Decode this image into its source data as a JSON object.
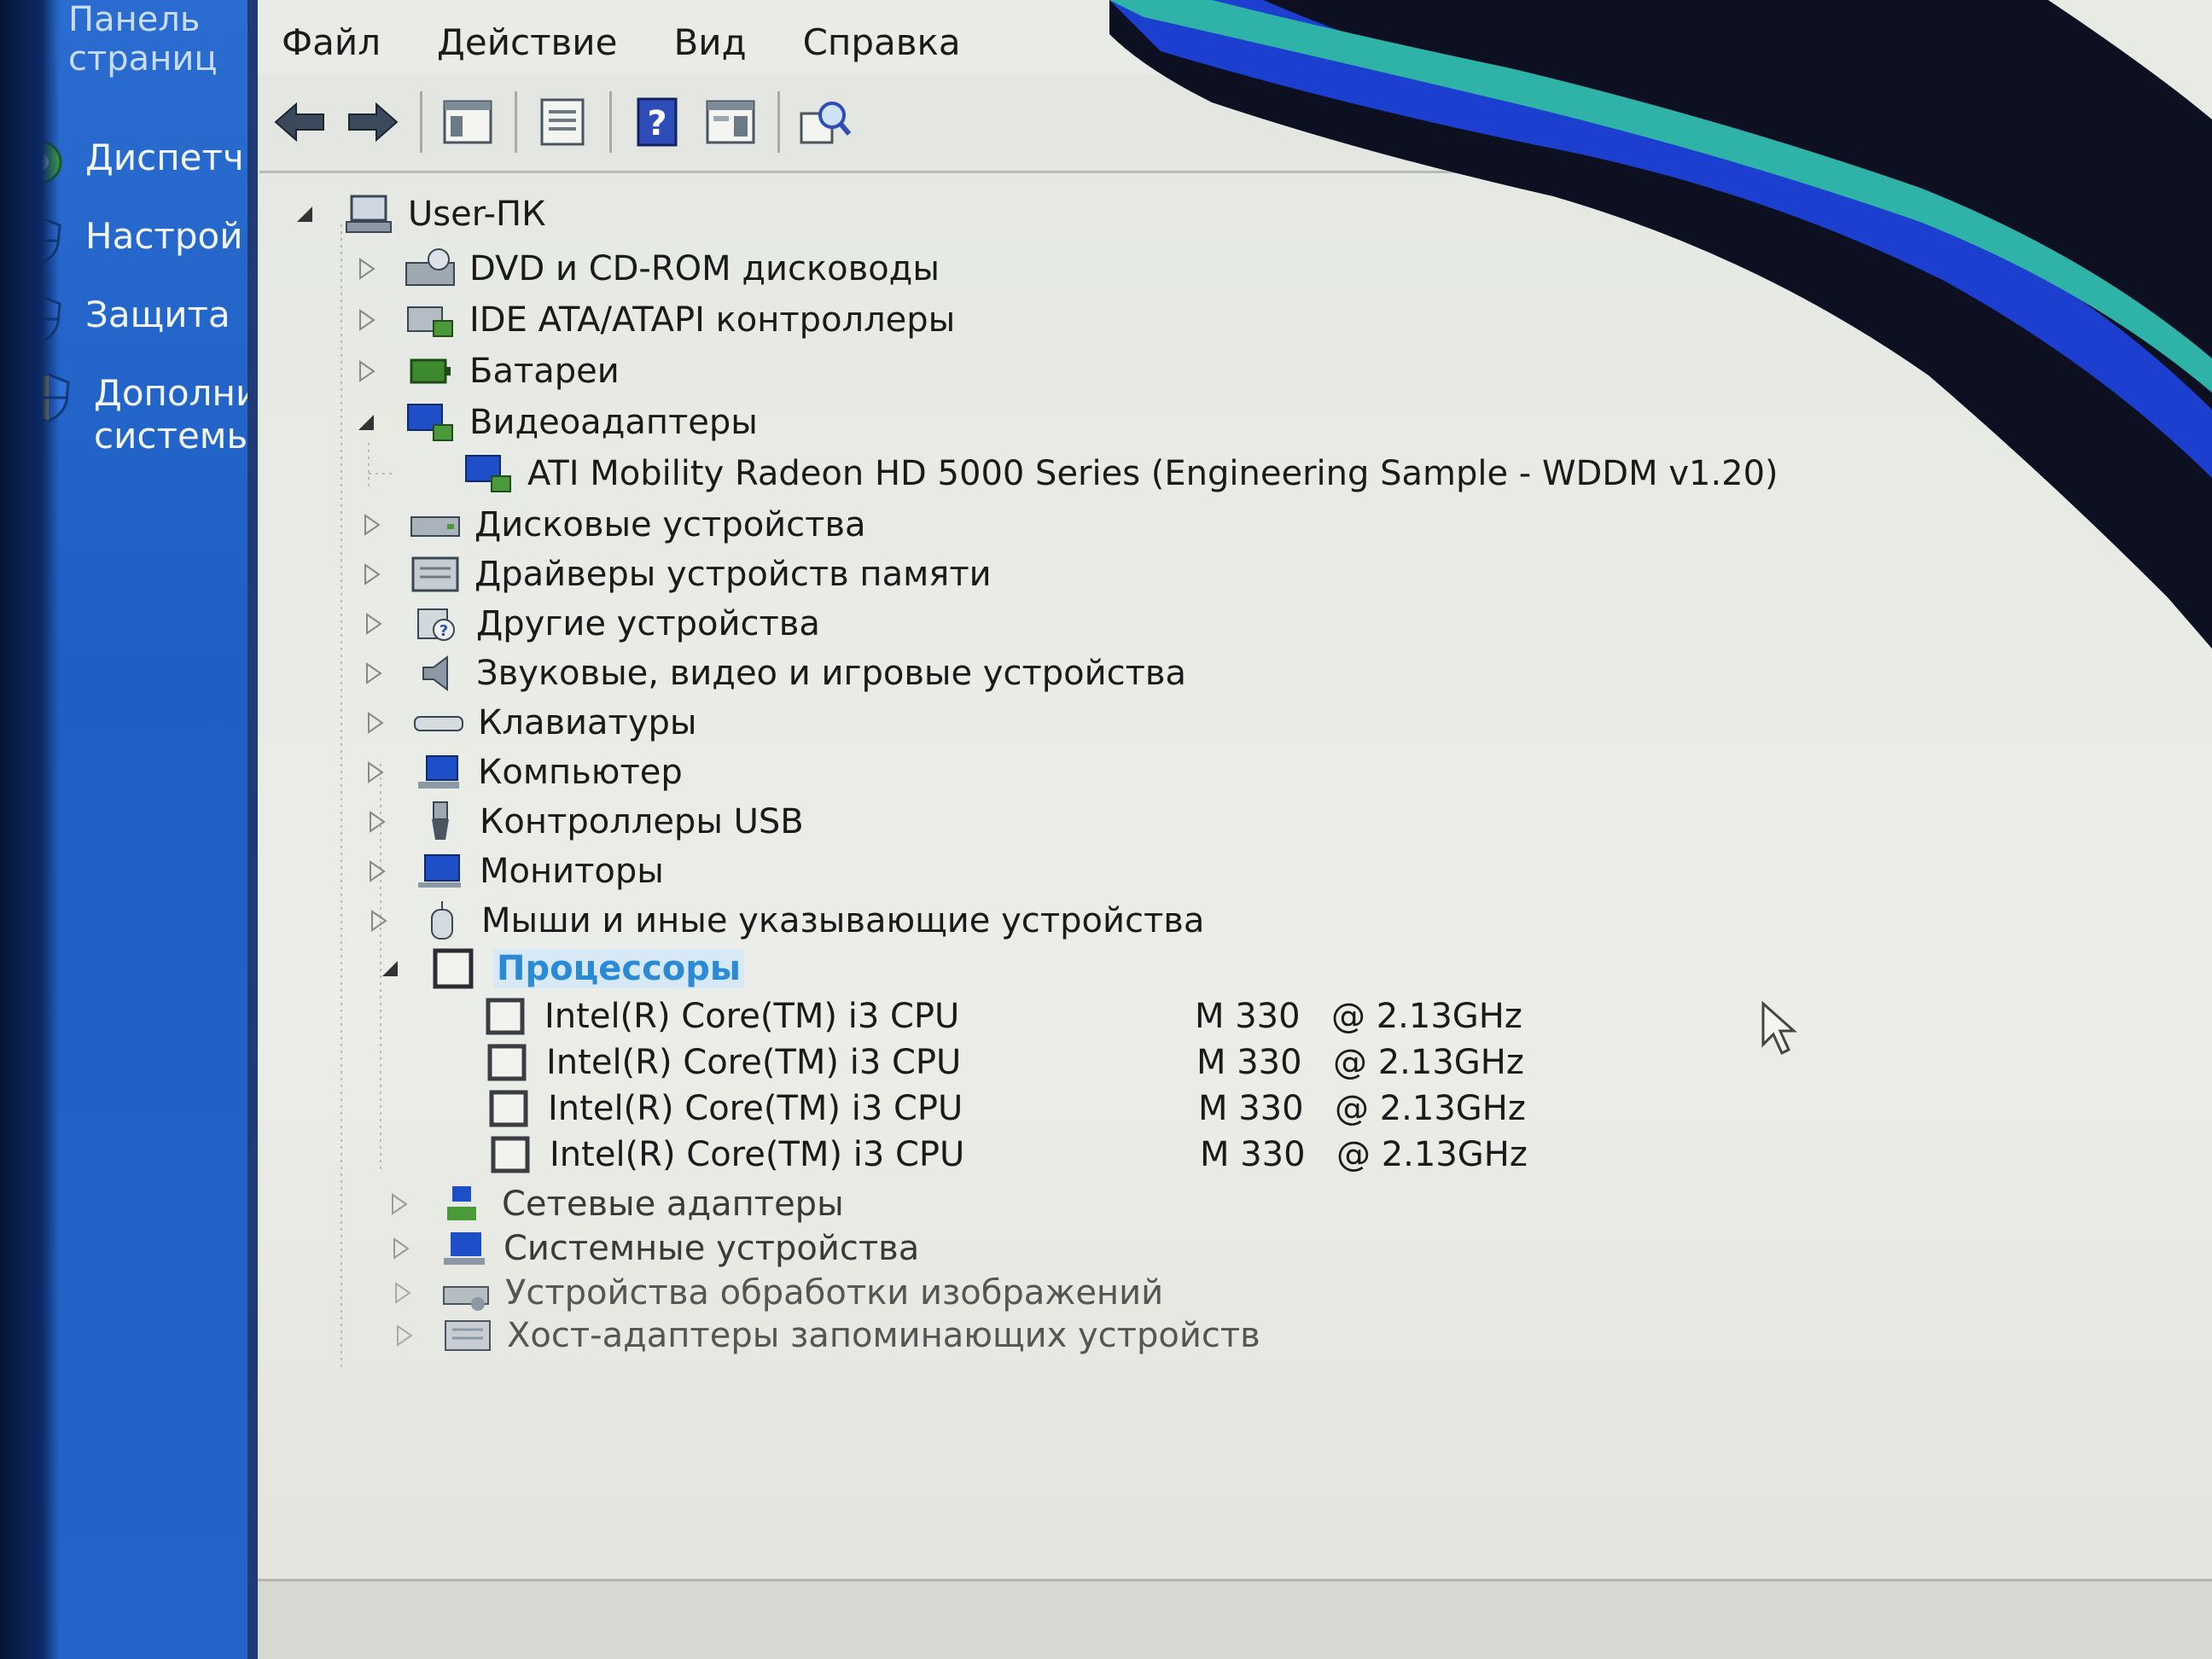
{
  "left_pane": {
    "breadcrumb": "Панель\nстраниц",
    "tasks": [
      {
        "label": "Диспетч",
        "icon": "device-manager-icon"
      },
      {
        "label": "Настрой",
        "icon": "shield-icon"
      },
      {
        "label": "Защита",
        "icon": "shield-icon"
      },
      {
        "label": "Дополни\nсистемы",
        "icon": "shield-icon"
      }
    ]
  },
  "menubar": {
    "file": "Файл",
    "action": "Действие",
    "view": "Вид",
    "help": "Справка"
  },
  "toolbar": {
    "buttons": [
      "back-arrow-icon",
      "forward-arrow-icon",
      "show-hide-tree-icon",
      "properties-icon",
      "help-icon",
      "console-tree-icon",
      "scan-hardware-icon"
    ]
  },
  "tree": {
    "root": "User-ПК",
    "categories": [
      {
        "label": "DVD и CD-ROM дисководы",
        "expanded": false
      },
      {
        "label": "IDE ATA/ATAPI контроллеры",
        "expanded": false
      },
      {
        "label": "Батареи",
        "expanded": false
      },
      {
        "label": "Видеоадаптеры",
        "expanded": true,
        "children": [
          "ATI Mobility Radeon HD 5000 Series (Engineering Sample - WDDM v1.20)"
        ]
      },
      {
        "label": "Дисковые устройства",
        "expanded": false
      },
      {
        "label": "Драйверы устройств памяти",
        "expanded": false
      },
      {
        "label": "Другие устройства",
        "expanded": false
      },
      {
        "label": "Звуковые, видео и игровые устройства",
        "expanded": false
      },
      {
        "label": "Клавиатуры",
        "expanded": false
      },
      {
        "label": "Компьютер",
        "expanded": false
      },
      {
        "label": "Контроллеры USB",
        "expanded": false
      },
      {
        "label": "Мониторы",
        "expanded": false
      },
      {
        "label": "Мыши и иные указывающие устройства",
        "expanded": false
      },
      {
        "label": "Процессоры",
        "expanded": true,
        "selected": true
      },
      {
        "label": "Сетевые адаптеры",
        "expanded": false
      },
      {
        "label": "Системные устройства",
        "expanded": false
      },
      {
        "label": "Устройства обработки изображений",
        "expanded": false
      },
      {
        "label": "Хост-адаптеры запоминающих устройств",
        "expanded": false
      }
    ],
    "cpus": [
      {
        "name": "Intel(R) Core(TM) i3 CPU",
        "model": "M 330",
        "freq": "@ 2.13GHz"
      },
      {
        "name": "Intel(R) Core(TM) i3 CPU",
        "model": "M 330",
        "freq": "@ 2.13GHz"
      },
      {
        "name": "Intel(R) Core(TM) i3 CPU",
        "model": "M 330",
        "freq": "@ 2.13GHz"
      },
      {
        "name": "Intel(R) Core(TM) i3 CPU",
        "model": "M 330",
        "freq": "@ 2.13GHz"
      }
    ]
  },
  "colors": {
    "selection_text": "#2a8ad6",
    "task_pane": "#2464c8",
    "wallpaper_blue": "#1d3fd0",
    "wallpaper_teal": "#2fb3a8"
  }
}
